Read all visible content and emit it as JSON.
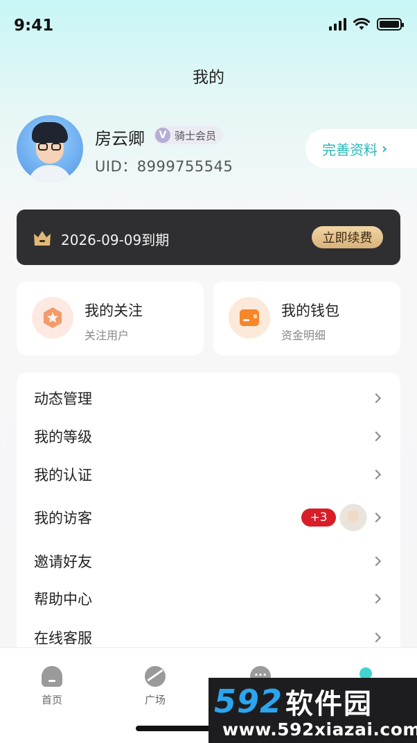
{
  "status_bar": {
    "time": "9:41"
  },
  "header": {
    "title": "我的"
  },
  "profile": {
    "name": "房云卿",
    "badge_letter": "V",
    "badge_text": "骑士会员",
    "uid": "UID：8999755545",
    "complete_label": "完善资料",
    "complete_chevron": "›"
  },
  "membership": {
    "expire_text": "2026-09-09到期",
    "renew_label": "立即续费"
  },
  "quick_cards": [
    {
      "title": "我的关注",
      "subtitle": "关注用户",
      "icon": "star-icon"
    },
    {
      "title": "我的钱包",
      "subtitle": "资金明细",
      "icon": "wallet-icon"
    }
  ],
  "menu": [
    {
      "label": "动态管理"
    },
    {
      "label": "我的等级"
    },
    {
      "label": "我的认证"
    },
    {
      "label": "我的访客",
      "badge": "+3"
    },
    {
      "label": "邀请好友"
    },
    {
      "label": "帮助中心"
    },
    {
      "label": "在线客服"
    }
  ],
  "tabbar": [
    {
      "label": "首页",
      "icon": "home-icon"
    },
    {
      "label": "广场",
      "icon": "planet-icon"
    },
    {
      "label": "",
      "icon": "message-icon"
    },
    {
      "label": "",
      "icon": "mine-icon"
    }
  ],
  "watermark": {
    "logo_num": "592",
    "logo_cn": "软件园",
    "url": "www.592xiazai.com"
  },
  "colors": {
    "accent": "#27b8b5",
    "vip_bar": "#2f2f31",
    "renew_gold": "#d8b27b",
    "badge_red": "#d91d27"
  }
}
